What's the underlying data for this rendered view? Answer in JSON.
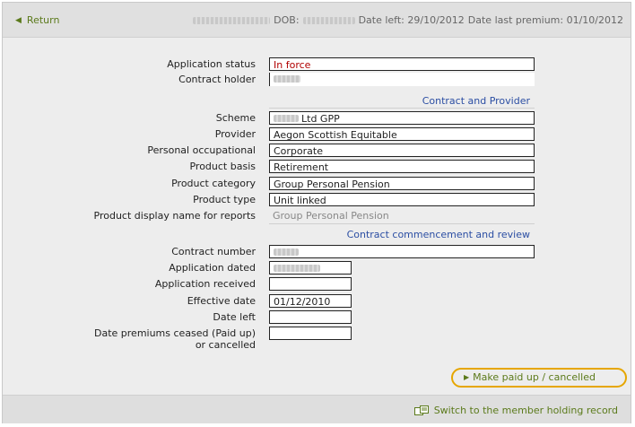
{
  "header": {
    "return_label": "Return",
    "dob_label": "DOB:",
    "date_left": "Date left: 29/10/2012",
    "date_last_premium": "Date last premium: 01/10/2012"
  },
  "fields": {
    "application_status": {
      "label": "Application status",
      "value": "In force"
    },
    "contract_holder": {
      "label": "Contract holder"
    },
    "scheme": {
      "label": "Scheme",
      "value": "Ltd GPP"
    },
    "provider": {
      "label": "Provider",
      "value": "Aegon Scottish Equitable"
    },
    "personal_occupational": {
      "label": "Personal occupational",
      "value": "Corporate"
    },
    "product_basis": {
      "label": "Product basis",
      "value": "Retirement"
    },
    "product_category": {
      "label": "Product category",
      "value": "Group Personal Pension"
    },
    "product_type": {
      "label": "Product type",
      "value": "Unit linked"
    },
    "product_display_name": {
      "label": "Product display name for reports",
      "value": "Group Personal Pension"
    },
    "contract_number": {
      "label": "Contract number"
    },
    "application_dated": {
      "label": "Application dated"
    },
    "application_received": {
      "label": "Application received"
    },
    "effective_date": {
      "label": "Effective date",
      "value": "01/12/2010"
    },
    "date_left": {
      "label": "Date left"
    },
    "date_premiums_ceased_1": {
      "label": "Date premiums ceased (Paid up)"
    },
    "date_premiums_ceased_2": {
      "label": "or cancelled"
    }
  },
  "sections": {
    "contract_provider": "Contract and Provider",
    "commencement_review": "Contract commencement and review"
  },
  "actions": {
    "make_paid_up": "Make paid up / cancelled",
    "switch_member": "Switch to the member holding record"
  },
  "colors": {
    "link_green": "#5b7a1b",
    "section_blue": "#2b4ea3",
    "status_red": "#b00000",
    "highlight_orange": "#e6a600"
  }
}
